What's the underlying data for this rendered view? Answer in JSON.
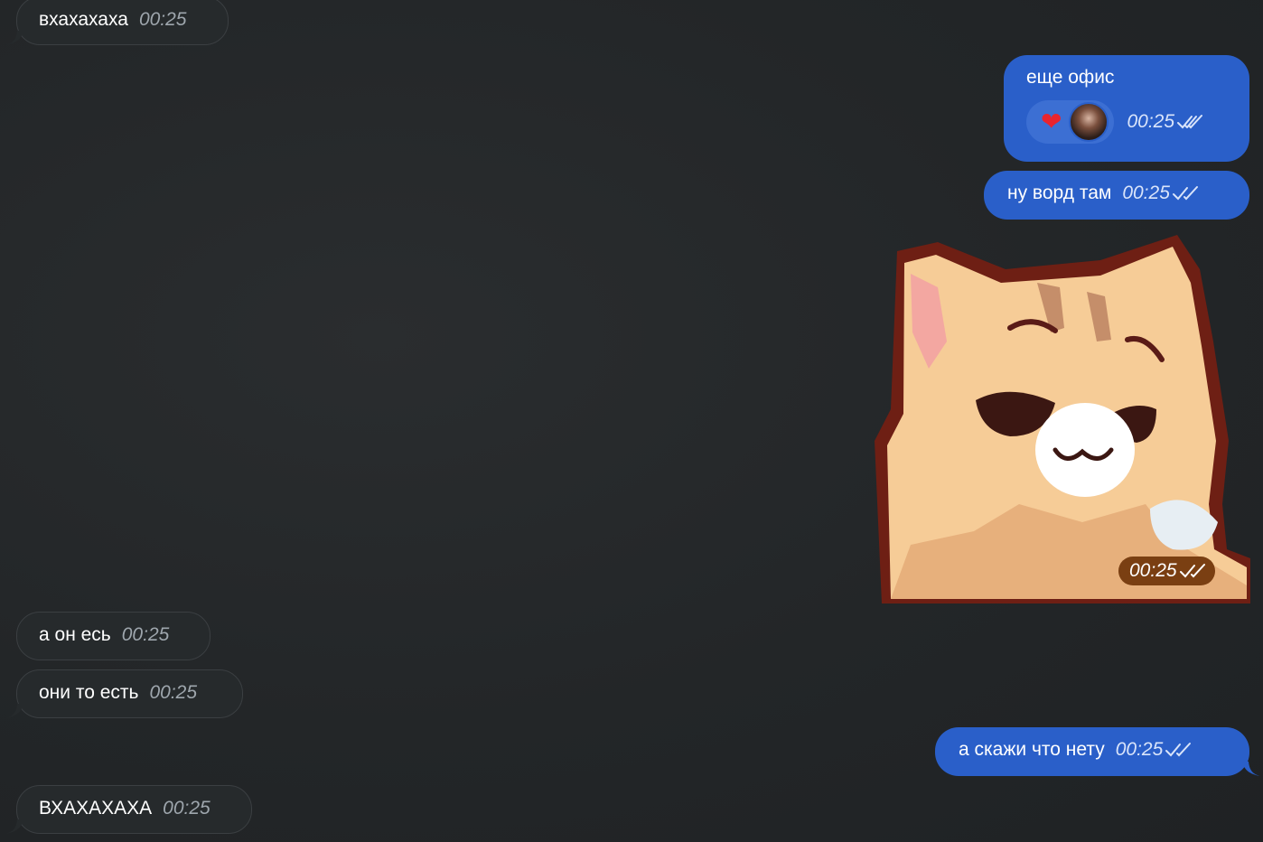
{
  "messages": [
    {
      "id": "m1",
      "direction": "incoming",
      "text": "вхахахаха",
      "time": "00:25"
    },
    {
      "id": "m2",
      "direction": "outgoing",
      "text": "еще офис",
      "time": "00:25",
      "reactions": [
        "❤"
      ],
      "reaction_icon": "heart-icon"
    },
    {
      "id": "m3",
      "direction": "outgoing",
      "text": "ну ворд там",
      "time": "00:25"
    },
    {
      "id": "m4",
      "direction": "outgoing",
      "type": "sticker",
      "sticker": "smug-cat",
      "time": "00:25"
    },
    {
      "id": "m5",
      "direction": "incoming",
      "text": "а он есь",
      "time": "00:25"
    },
    {
      "id": "m6",
      "direction": "incoming",
      "text": "они то есть",
      "time": "00:25"
    },
    {
      "id": "m7",
      "direction": "outgoing",
      "text": "а скажи что нету",
      "time": "00:25"
    },
    {
      "id": "m8",
      "direction": "incoming",
      "text": "ВХАХАХАХА",
      "time": "00:25"
    }
  ],
  "colors": {
    "background": "#232628",
    "incoming_bubble": "#262a2c",
    "outgoing_bubble": "#2a5fc9",
    "reaction_pill": "#3c6fd3",
    "sticker_time_pill": "#7a3f12"
  }
}
